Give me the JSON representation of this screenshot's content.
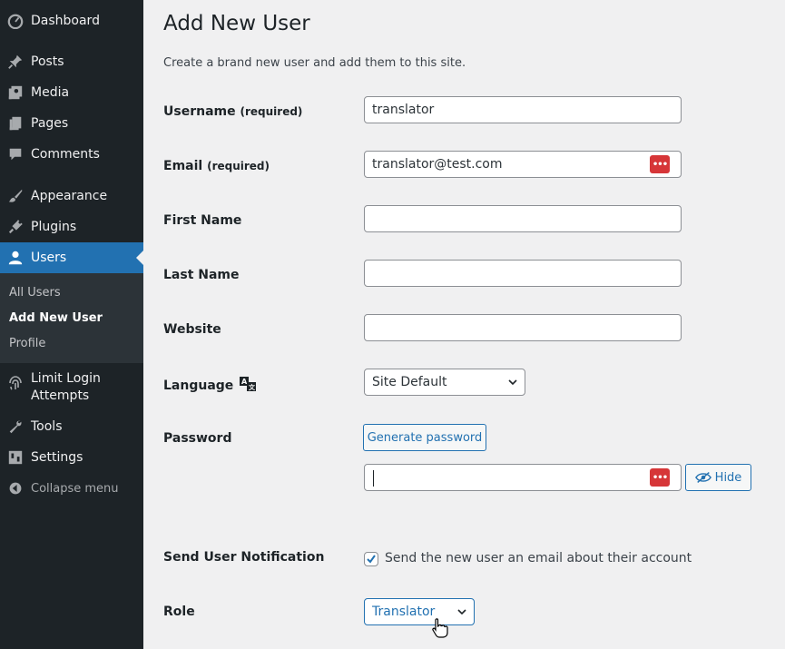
{
  "sidebar": {
    "items": [
      {
        "label": "Dashboard",
        "icon": "dashboard-icon"
      },
      {
        "label": "Posts",
        "icon": "pin-icon"
      },
      {
        "label": "Media",
        "icon": "media-icon"
      },
      {
        "label": "Pages",
        "icon": "pages-icon"
      },
      {
        "label": "Comments",
        "icon": "comment-icon"
      },
      {
        "label": "Appearance",
        "icon": "brush-icon"
      },
      {
        "label": "Plugins",
        "icon": "plug-icon"
      },
      {
        "label": "Users",
        "icon": "user-icon"
      },
      {
        "label": "Limit Login Attempts",
        "icon": "fingerprint-icon"
      },
      {
        "label": "Tools",
        "icon": "wrench-icon"
      },
      {
        "label": "Settings",
        "icon": "settings-icon"
      },
      {
        "label": "Collapse menu",
        "icon": "collapse-icon"
      }
    ],
    "submenu": [
      "All Users",
      "Add New User",
      "Profile"
    ]
  },
  "page": {
    "title": "Add New User",
    "intro": "Create a brand new user and add them to this site."
  },
  "form": {
    "username_label": "Username",
    "username_req": "(required)",
    "username_value": "translator",
    "email_label": "Email",
    "email_req": "(required)",
    "email_value": "translator@test.com",
    "first_name_label": "First Name",
    "last_name_label": "Last Name",
    "website_label": "Website",
    "language_label": "Language",
    "language_value": "Site Default",
    "password_label": "Password",
    "generate_password": "Generate password",
    "hide_label": "Hide",
    "notify_label": "Send User Notification",
    "notify_text": "Send the new user an email about their account",
    "notify_checked": true,
    "role_label": "Role",
    "role_value": "Translator"
  },
  "colors": {
    "sidebar_bg": "#1d2327",
    "accent": "#2271b1",
    "password_manager_icon": "#d63638"
  }
}
